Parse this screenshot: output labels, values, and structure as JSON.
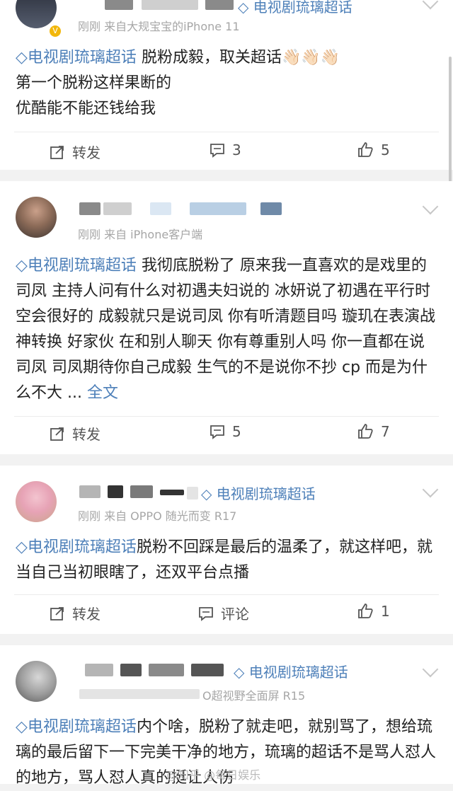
{
  "posts": [
    {
      "header_topic": "电视剧琉璃超话",
      "meta": "刚刚 来自大规宝宝的iPhone 11",
      "topic": "电视剧琉璃超话",
      "lines": [
        "脱粉成毅，取关超话👋🏻👋🏻👋🏻",
        "第一个脱粉这样果断的",
        "优酷能不能还钱给我"
      ],
      "actions": {
        "repost": "转发",
        "comments": "3",
        "likes": "5"
      }
    },
    {
      "meta": "刚刚 来自 iPhone客户端",
      "topic": "电视剧琉璃超话",
      "text": " 我彻底脱粉了 原来我一直喜欢的是戏里的司凤 主持人问有什么对初遇夫妇说的 冰妍说了初遇在平行时空会很好的 成毅就只是说司凤 你有听清题目吗 璇玑在表演战神转换 好家伙 在和别人聊天 你有尊重别人吗 你一直都在说司凤 司凤期待你自己成毅 生气的不是说你不抄 cp 而是为什么不大 ...",
      "more": "全文",
      "actions": {
        "repost": "转发",
        "comments": "5",
        "likes": "7"
      }
    },
    {
      "header_topic": "电视剧琉璃超话",
      "meta": "刚刚 来自 OPPO 随光而变 R17",
      "topic": "电视剧琉璃超话",
      "text": "脱粉不回踩是最后的温柔了，就这样吧，就当自己当初眼瞎了，还双平台点播",
      "actions": {
        "repost": "转发",
        "comments": "评论",
        "likes": "1"
      }
    },
    {
      "header_topic": "电视剧琉璃超话",
      "meta": "O超视野全面屏 R15",
      "topic": "电视剧琉璃超话",
      "text": "内个啥，脱粉了就走吧，就别骂了，想给琉璃的最后留下一下完美干净的地方，琉璃的超话不是骂人怼人的地方，骂人怼人真的挺让人伤"
    }
  ],
  "watermark": "@知乎 @每日娱乐",
  "colors": {
    "link": "#4e80b9",
    "text": "#222222",
    "meta": "#a6a6a6",
    "bg": "#f2f2f2"
  },
  "icons": [
    "topic-diamond-icon",
    "repost-icon",
    "comment-icon",
    "like-icon",
    "chevron-down-icon",
    "verified-badge-icon"
  ]
}
